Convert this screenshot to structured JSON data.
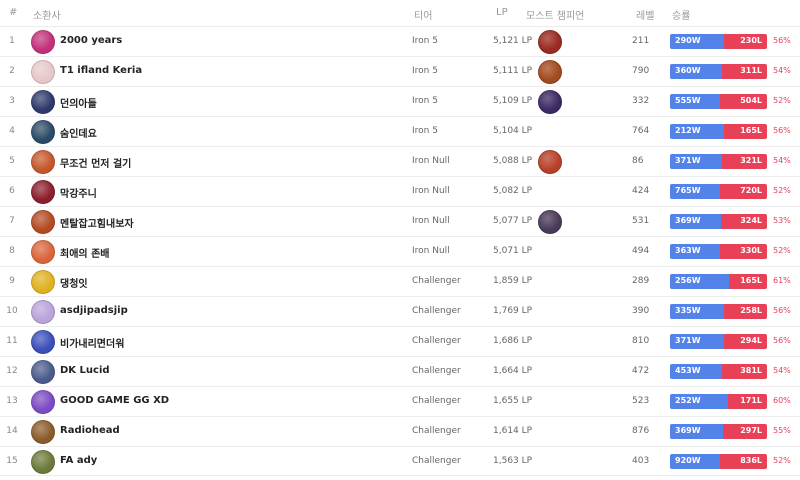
{
  "header": {
    "rank": "#",
    "summoner": "소환사",
    "tier": "티어",
    "lp": "LP",
    "most_champions": "모스트 챔피언",
    "level": "레벨",
    "win_rate": "승률"
  },
  "colors": {
    "win": "#5383e8",
    "loss": "#e84057",
    "row_border": "#ececec"
  },
  "rows": [
    {
      "rank": "1",
      "name": "2000 years",
      "tier": "Iron 5",
      "lp": "5,121 LP",
      "level": "211",
      "wins": "290W",
      "losses": "230L",
      "pct": "56%",
      "win_frac": 0.56,
      "avatar": "#c2307a",
      "champ": "#9a2a22"
    },
    {
      "rank": "2",
      "name": "T1 ifland Keria",
      "tier": "Iron 5",
      "lp": "5,111 LP",
      "level": "790",
      "wins": "360W",
      "losses": "311L",
      "pct": "54%",
      "win_frac": 0.54,
      "avatar": "#e6c7c9",
      "champ": "#a34a1e"
    },
    {
      "rank": "3",
      "name": "던의아들",
      "tier": "Iron 5",
      "lp": "5,109 LP",
      "level": "332",
      "wins": "555W",
      "losses": "504L",
      "pct": "52%",
      "win_frac": 0.52,
      "avatar": "#2f3a6b",
      "champ": "#3b2a63"
    },
    {
      "rank": "4",
      "name": "숨인데요",
      "tier": "Iron 5",
      "lp": "5,104 LP",
      "level": "764",
      "wins": "212W",
      "losses": "165L",
      "pct": "56%",
      "win_frac": 0.56,
      "avatar": "#2a4a66",
      "champ": ""
    },
    {
      "rank": "5",
      "name": "무조건 먼저 걸기",
      "tier": "Iron Null",
      "lp": "5,088 LP",
      "level": "86",
      "wins": "371W",
      "losses": "321L",
      "pct": "54%",
      "win_frac": 0.54,
      "avatar": "#c4562a",
      "champ": "#b8402a"
    },
    {
      "rank": "6",
      "name": "막강주니",
      "tier": "Iron Null",
      "lp": "5,082 LP",
      "level": "424",
      "wins": "765W",
      "losses": "720L",
      "pct": "52%",
      "win_frac": 0.52,
      "avatar": "#8a1e2a",
      "champ": ""
    },
    {
      "rank": "7",
      "name": "멘탈잡고힘내보자",
      "tier": "Iron Null",
      "lp": "5,077 LP",
      "level": "531",
      "wins": "369W",
      "losses": "324L",
      "pct": "53%",
      "win_frac": 0.53,
      "avatar": "#b34a22",
      "champ": "#4a3a5a"
    },
    {
      "rank": "8",
      "name": "최애의 존배",
      "tier": "Iron Null",
      "lp": "5,071 LP",
      "level": "494",
      "wins": "363W",
      "losses": "330L",
      "pct": "52%",
      "win_frac": 0.52,
      "avatar": "#d9643a",
      "champ": ""
    },
    {
      "rank": "9",
      "name": "댕청잇",
      "tier": "Challenger",
      "lp": "1,859 LP",
      "level": "289",
      "wins": "256W",
      "losses": "165L",
      "pct": "61%",
      "win_frac": 0.61,
      "avatar": "#e0b020",
      "champ": ""
    },
    {
      "rank": "10",
      "name": "asdjipadsjip",
      "tier": "Challenger",
      "lp": "1,769 LP",
      "level": "390",
      "wins": "335W",
      "losses": "258L",
      "pct": "56%",
      "win_frac": 0.56,
      "avatar": "#b9a3d9",
      "champ": ""
    },
    {
      "rank": "11",
      "name": "비가내리면더워",
      "tier": "Challenger",
      "lp": "1,686 LP",
      "level": "810",
      "wins": "371W",
      "losses": "294L",
      "pct": "56%",
      "win_frac": 0.56,
      "avatar": "#3a4fb8",
      "champ": ""
    },
    {
      "rank": "12",
      "name": "DK Lucid",
      "tier": "Challenger",
      "lp": "1,664 LP",
      "level": "472",
      "wins": "453W",
      "losses": "381L",
      "pct": "54%",
      "win_frac": 0.54,
      "avatar": "#4b5a8a",
      "champ": ""
    },
    {
      "rank": "13",
      "name": "GOOD GAME GG XD",
      "tier": "Challenger",
      "lp": "1,655 LP",
      "level": "523",
      "wins": "252W",
      "losses": "171L",
      "pct": "60%",
      "win_frac": 0.6,
      "avatar": "#7b4ac4",
      "champ": ""
    },
    {
      "rank": "14",
      "name": "Radiohead",
      "tier": "Challenger",
      "lp": "1,614 LP",
      "level": "876",
      "wins": "369W",
      "losses": "297L",
      "pct": "55%",
      "win_frac": 0.55,
      "avatar": "#8a5a2a",
      "champ": ""
    },
    {
      "rank": "15",
      "name": "FA ady",
      "tier": "Challenger",
      "lp": "1,563 LP",
      "level": "403",
      "wins": "920W",
      "losses": "836L",
      "pct": "52%",
      "win_frac": 0.52,
      "avatar": "#6b7a3a",
      "champ": ""
    }
  ]
}
